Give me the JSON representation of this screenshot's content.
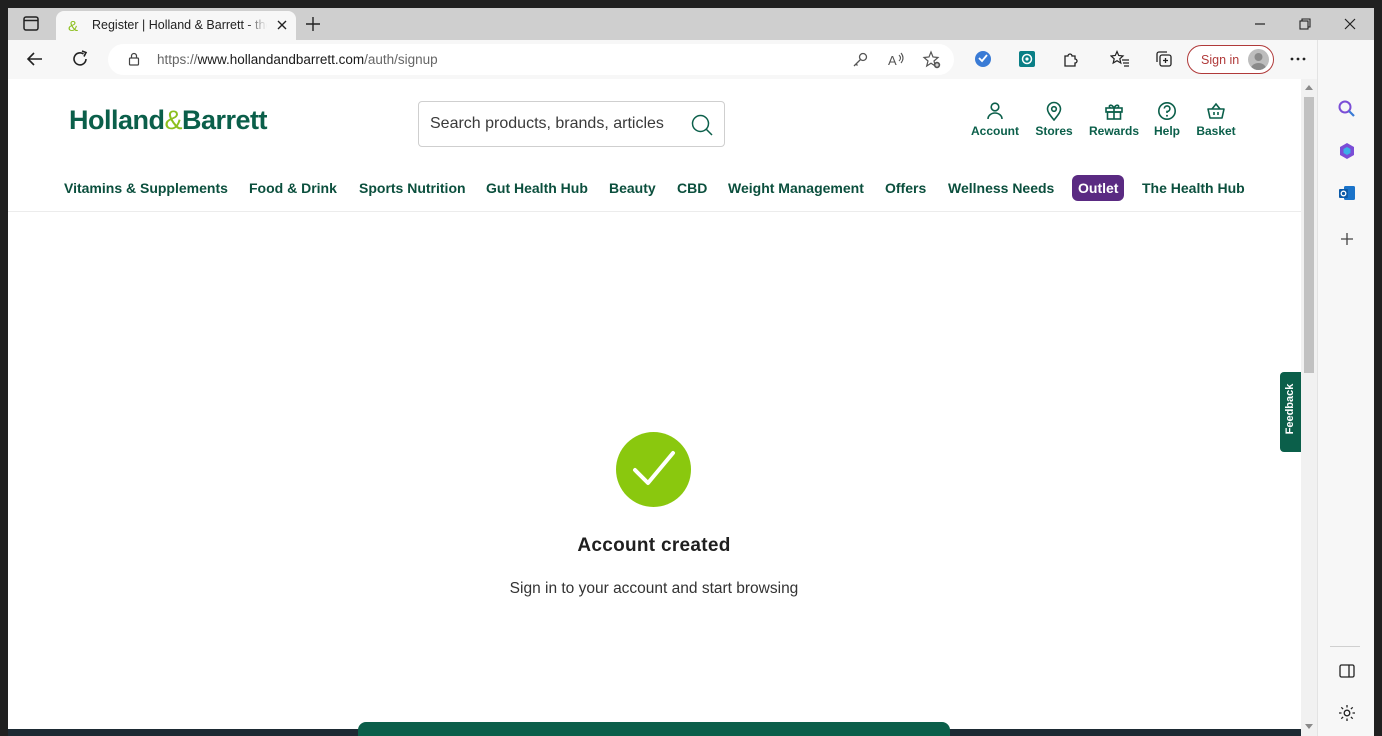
{
  "browser": {
    "tab_title": "Register | Holland & Barrett - the UK's Leading Health Retailer",
    "url_prefix": "https://",
    "url_host": "www.hollandandbarrett.com",
    "url_path": "/auth/signup",
    "sign_in_label": "Sign in"
  },
  "site": {
    "logo_left": "Holland",
    "logo_amp": "&",
    "logo_right": "Barrett",
    "search_placeholder": "Search products, brands, articles",
    "header_links": [
      "Account",
      "Stores",
      "Rewards",
      "Help",
      "Basket"
    ],
    "nav": [
      "Vitamins & Supplements",
      "Food & Drink",
      "Sports Nutrition",
      "Gut Health Hub",
      "Beauty",
      "CBD",
      "Weight Management",
      "Offers",
      "Wellness Needs",
      "Outlet",
      "The Health Hub"
    ],
    "feedback_label": "Feedback"
  },
  "main": {
    "heading": "Account created",
    "subtext": "Sign in to your account and start browsing"
  },
  "colors": {
    "brand_green": "#0b5f4a",
    "accent_lime": "#8ac80e",
    "outlet_purple": "#5a2a82"
  }
}
